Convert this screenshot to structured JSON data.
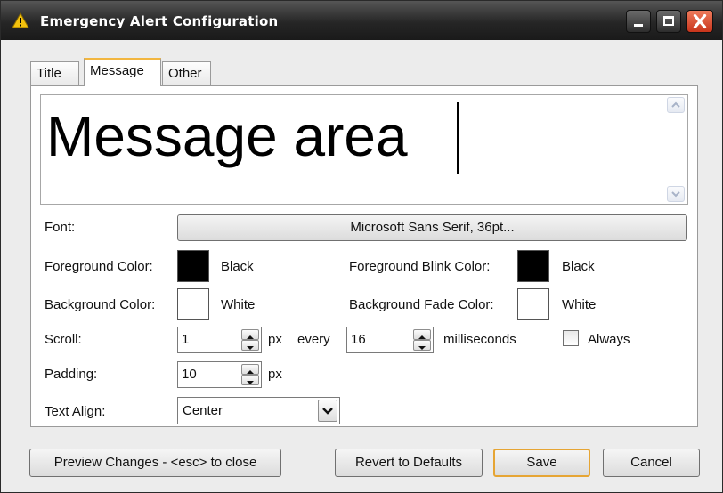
{
  "window": {
    "title": "Emergency Alert Configuration",
    "title_icon": "warning-icon",
    "controls": [
      "minimize-icon",
      "maximize-icon",
      "close-icon"
    ]
  },
  "tabs": [
    {
      "label": "Title",
      "active": false
    },
    {
      "label": "Message",
      "active": true
    },
    {
      "label": "Other",
      "active": false
    }
  ],
  "message": {
    "text": "Message area"
  },
  "font": {
    "label": "Font:",
    "value": "Microsoft Sans Serif, 36pt..."
  },
  "colors": {
    "fg_label": "Foreground Color:",
    "fg_name": "Black",
    "fg_hex": "#000000",
    "bg_label": "Background Color:",
    "bg_name": "White",
    "bg_hex": "#ffffff",
    "fg_blink_label": "Foreground Blink Color:",
    "fg_blink_name": "Black",
    "fg_blink_hex": "#000000",
    "bg_fade_label": "Background Fade Color:",
    "bg_fade_name": "White",
    "bg_fade_hex": "#ffffff"
  },
  "scroll": {
    "label": "Scroll:",
    "amount": "1",
    "unit": "px",
    "every": "every",
    "interval": "16",
    "interval_unit": "milliseconds",
    "always_label": "Always",
    "always_checked": false
  },
  "padding": {
    "label": "Padding:",
    "value": "10",
    "unit": "px"
  },
  "align": {
    "label": "Text Align:",
    "value": "Center"
  },
  "buttons": {
    "preview": "Preview Changes - <esc> to close",
    "revert": "Revert to Defaults",
    "save": "Save",
    "cancel": "Cancel"
  }
}
